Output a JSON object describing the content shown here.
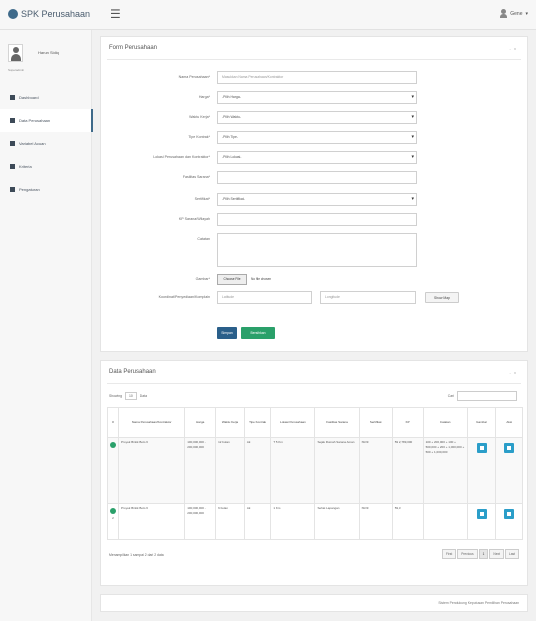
{
  "app": {
    "brand": "SPK Perusahaan",
    "user": "Gene"
  },
  "sidebar": {
    "profile_name": "Harun Sidiq",
    "profile_role": "Superadmin",
    "items": [
      {
        "label": "Dashboard"
      },
      {
        "label": "Data Perusahaan"
      },
      {
        "label": "Variabel Acuan"
      },
      {
        "label": "Kriteria"
      },
      {
        "label": "Pengaturan"
      }
    ]
  },
  "form_panel": {
    "title": "Form Perusahaan",
    "tools": "- x",
    "fields": [
      {
        "label": "Nama Perusahaan*",
        "value": "Masukkan Nama Perusahaan/Kontraktor",
        "kind": "input"
      },
      {
        "label": "Harga*",
        "value": "-Pilih Harga-",
        "kind": "select"
      },
      {
        "label": "Waktu Kerja*",
        "value": "-Pilih Waktu-",
        "kind": "select"
      },
      {
        "label": "Tipe Kontrak*",
        "value": "-Pilih Tipe-",
        "kind": "select"
      },
      {
        "label": "Lokasi Perusahaan dan Kontraktor*",
        "value": "-Pilih Lokasi-",
        "kind": "select"
      },
      {
        "label": "Fasilitas Sarana*",
        "value": "",
        "kind": "input"
      },
      {
        "label": "Sertifikat*",
        "value": "-Pilih Sertifikat-",
        "kind": "select"
      },
      {
        "label": "KP Sarana/Wilayah",
        "value": "",
        "kind": "input"
      },
      {
        "label": "Catatan",
        "value": "",
        "kind": "textarea"
      },
      {
        "label": "Gambar*",
        "value": "",
        "kind": "file"
      },
      {
        "label": "Koordinat/Penyediaan/Komplain",
        "value": "",
        "kind": "coords"
      }
    ],
    "file_button": "Choose File",
    "file_status": "No file chosen",
    "latitude_placeholder": "Latitude",
    "longitude_placeholder": "Longitude",
    "show_map_button": "Show Map",
    "save_button": "Simpan",
    "reset_button": "Bersihkan"
  },
  "table_panel": {
    "title": "Data Perusahaan",
    "tools": "- x",
    "show_label": "Showing",
    "show_value": "10",
    "entries_label": "Data",
    "search_label": "Cari",
    "columns": [
      "#",
      "Nama Perusahaan/Kontraktor",
      "Harga",
      "Waktu Kerja",
      "Tipe Kontrak",
      "Lokasi Perusahaan",
      "Fasilitas Sarana",
      "Sertifikat",
      "KP",
      "Catatan",
      "Gambar",
      "Aksi"
    ],
    "rows": [
      {
        "no": "",
        "name": "Proyek Bintik Bolo 6",
        "harga": "100,000,000 - 200,000,000",
        "waktu": "12 bulan",
        "tipe": "Ak",
        "lokasi": "T 5 Km",
        "fasilitas": "Sejak Rumah Sarana Aman",
        "sertifikat": "ISO9",
        "kp": "59 2,789,000",
        "catatan": "100 + 200,000 + 100 + 500,000 + 200 + 1,000,000 + 500 + 1,000,000"
      },
      {
        "no": "2",
        "name": "Proyek Bintik Bolo 6",
        "harga": "100,000,000 - 200,000,000",
        "waktu": "6 bulan",
        "tipe": "Ak",
        "lokasi": "1 Km",
        "fasilitas": "Sehat Lapangan",
        "sertifikat": "ISO9",
        "kp": "59,3",
        "catatan": ""
      }
    ],
    "info": "Menampilkan 1 sampai 2 dari 2 data",
    "pagination": [
      "First",
      "Previous",
      "1",
      "Next",
      "Last"
    ]
  },
  "footer": {
    "text": "Sistem Pendukung Keputusan Pemilihan Perusahaan"
  }
}
